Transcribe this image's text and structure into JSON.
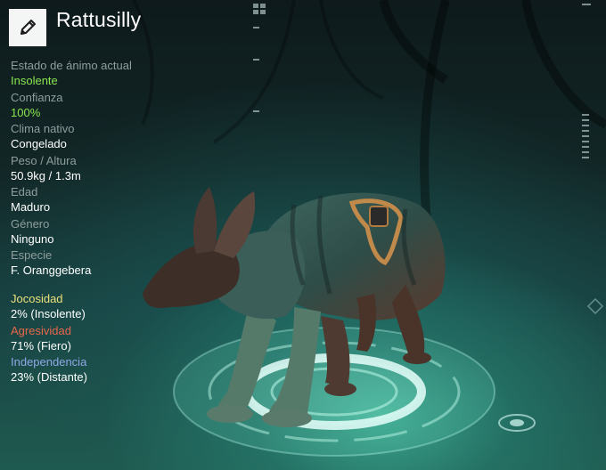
{
  "creature": {
    "name": "Rattusilly"
  },
  "edit_icon": "pencil-icon",
  "stats": [
    {
      "label": "Estado de ánimo actual",
      "value": "Insolente",
      "highlight": true
    },
    {
      "label": "Confianza",
      "value": "100%",
      "highlight": true
    },
    {
      "label": "Clima nativo",
      "value": "Congelado",
      "highlight": false
    },
    {
      "label": "Peso / Altura",
      "value": "50.9kg / 1.3m",
      "highlight": false
    },
    {
      "label": "Edad",
      "value": "Maduro",
      "highlight": false
    },
    {
      "label": "Género",
      "value": "Ninguno",
      "highlight": false
    },
    {
      "label": "Especie",
      "value": "F. Oranggebera",
      "highlight": false
    }
  ],
  "traits": [
    {
      "label": "Jocosidad",
      "value": "2% (Insolente)",
      "color": "#e9e07a"
    },
    {
      "label": "Agresividad",
      "value": "71% (Fiero)",
      "color": "#e8664a"
    },
    {
      "label": "Independencia",
      "value": "23% (Distante)",
      "color": "#8fa8e6"
    }
  ],
  "colors": {
    "accent_green": "#8ae64e",
    "label_gray": "#8f9d9d",
    "platform_glow": "#6fe0c0"
  }
}
